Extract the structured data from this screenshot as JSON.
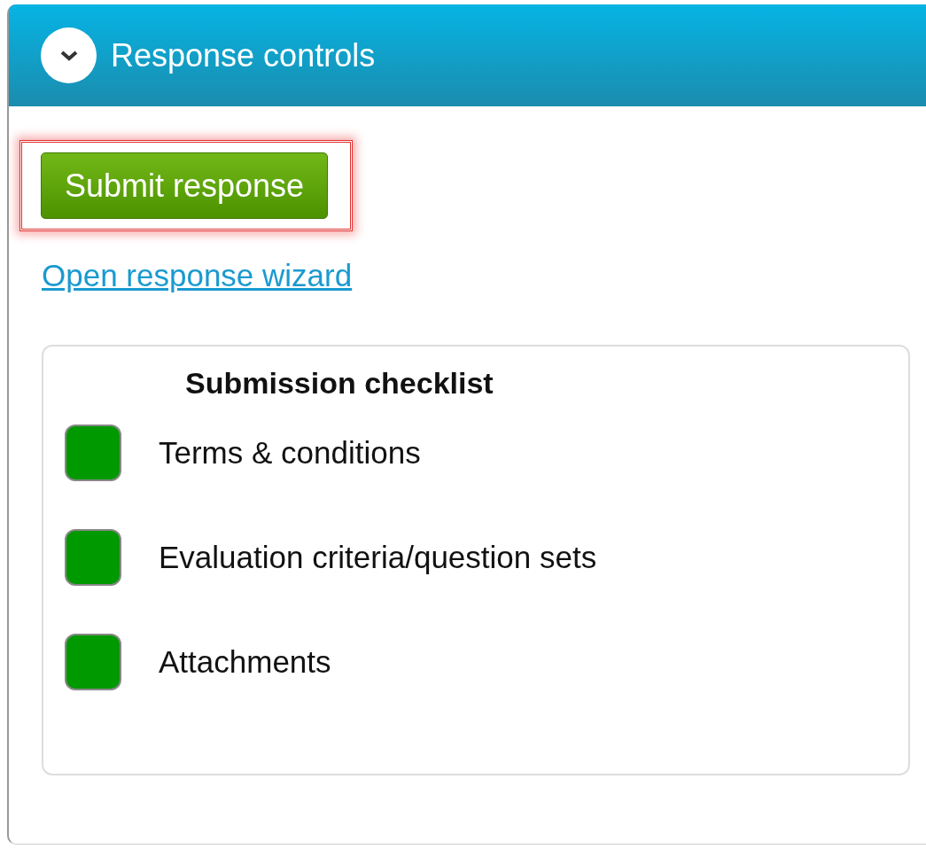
{
  "panel": {
    "title": "Response controls",
    "expanded": true
  },
  "submit_button": {
    "label": "Submit response",
    "highlighted": true
  },
  "wizard_link": "Open response wizard",
  "checklist": {
    "title": "Submission checklist",
    "items": [
      {
        "label": "Terms & conditions",
        "color": "#009900"
      },
      {
        "label": "Evaluation criteria/question sets",
        "color": "#009900"
      },
      {
        "label": "Attachments",
        "color": "#009900"
      }
    ]
  }
}
